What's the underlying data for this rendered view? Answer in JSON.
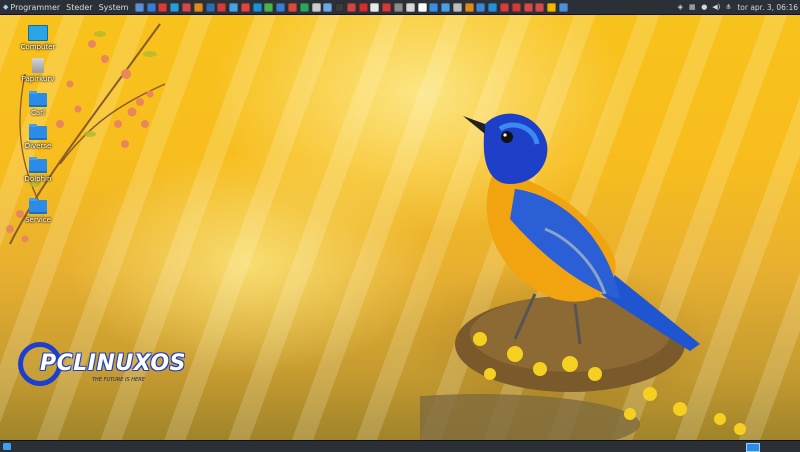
{
  "top_panel": {
    "menus": [
      {
        "label": "Programmer",
        "icon": "pclinuxos-logo-icon"
      },
      {
        "label": "Steder"
      },
      {
        "label": "System"
      }
    ],
    "launcher_colors": [
      "#5b8fd6",
      "#3a7bd5",
      "#d93a3a",
      "#2b9bd8",
      "#d44a4a",
      "#e08a1e",
      "#2c6fb0",
      "#d63b3b",
      "#4aa0e0",
      "#e04545",
      "#1f8fd9",
      "#4bb24f",
      "#3d7bd0",
      "#d84c3c",
      "#2fa35a",
      "#cccccc",
      "#6aa9e6",
      "#3b3b3b",
      "#d14545",
      "#cf2f2f",
      "#e9e9e9",
      "#d33a3a",
      "#8c8c8c",
      "#d9d9d9",
      "#ffffff",
      "#3a8ee0",
      "#4aa0e0",
      "#bdbdbd",
      "#e08a1e",
      "#3e86d6",
      "#2a8fd9",
      "#d83b3b",
      "#cf3a3a",
      "#d44a4a",
      "#d14b4b",
      "#f2b500",
      "#4f8fd8"
    ],
    "tray_icons": [
      "dropbox-icon",
      "keyboard-icon",
      "user-icon",
      "volume-icon",
      "network-icon"
    ],
    "clock": "tor apr. 3, 06:16"
  },
  "desktop_icons": [
    {
      "label": "Computer",
      "icon": "computer-icon"
    },
    {
      "label": "Papirkurv",
      "icon": "trash-icon"
    },
    {
      "label": "Carl",
      "icon": "home-folder-icon"
    },
    {
      "label": "Diverse",
      "icon": "folder-icon"
    },
    {
      "label": "Dolphin",
      "icon": "folder-icon"
    },
    {
      "label": "Service",
      "icon": "folder-icon"
    }
  ],
  "logo": {
    "word": "PCLINUXOS",
    "tagline": "THE FUTURE IS HERE"
  },
  "colors": {
    "panel": "#2b2f36",
    "accent": "#2a8ce6",
    "logo_blue": "#1c3fcf"
  }
}
